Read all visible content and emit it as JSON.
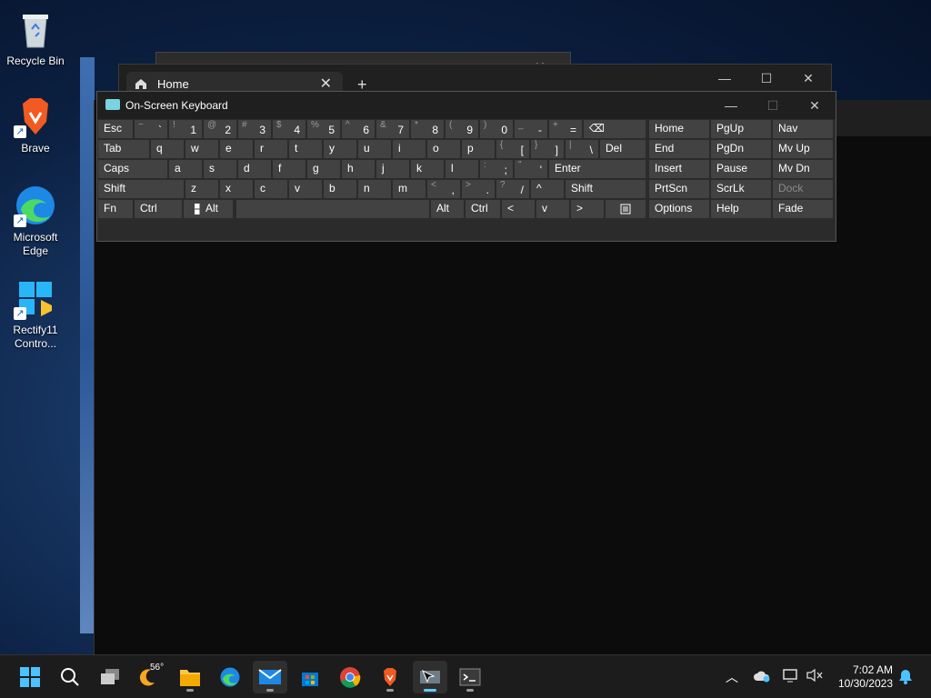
{
  "desktop": {
    "icons": [
      {
        "label": "Recycle Bin"
      },
      {
        "label": "Brave"
      },
      {
        "label": "Microsoft Edge"
      },
      {
        "label": "Rectify11 Contro..."
      }
    ]
  },
  "browser": {
    "tab_label": "Home",
    "new_tab": "+"
  },
  "osk": {
    "title": "On-Screen Keyboard",
    "rows": [
      [
        "Esc",
        "~`",
        "!1",
        "@2",
        "#3",
        "$4",
        "%5",
        "^6",
        "&7",
        "*8",
        "(9",
        ")0",
        "_-",
        "+=",
        "⌫"
      ],
      [
        "Tab",
        "q",
        "w",
        "e",
        "r",
        "t",
        "y",
        "u",
        "i",
        "o",
        "p",
        "{[",
        "}]",
        "|\\",
        "Del"
      ],
      [
        "Caps",
        "a",
        "s",
        "d",
        "f",
        "g",
        "h",
        "j",
        "k",
        "l",
        ":;",
        "\"'",
        "Enter"
      ],
      [
        "Shift",
        "z",
        "x",
        "c",
        "v",
        "b",
        "n",
        "m",
        "<,",
        ">.",
        "?/",
        "^",
        "Shift"
      ],
      [
        "Fn",
        "Ctrl",
        "Win",
        "Alt",
        "",
        "Alt",
        "Ctrl",
        "<",
        "v",
        ">",
        "Menu"
      ]
    ],
    "nav": [
      [
        "Home",
        "PgUp",
        "Nav"
      ],
      [
        "End",
        "PgDn",
        "Mv Up"
      ],
      [
        "Insert",
        "Pause",
        "Mv Dn"
      ],
      [
        "PrtScn",
        "ScrLk",
        "Dock"
      ],
      [
        "Options",
        "Help",
        "Fade"
      ]
    ]
  },
  "taskbar": {
    "weather_temp": "56°",
    "time": "7:02 AM",
    "date": "10/30/2023"
  }
}
